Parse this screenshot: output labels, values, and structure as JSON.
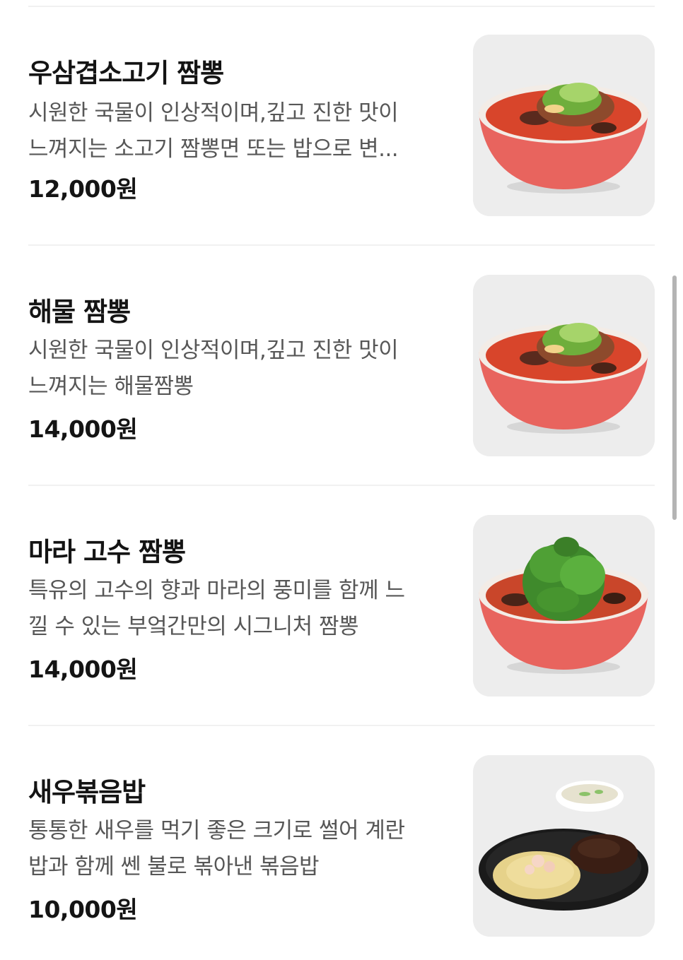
{
  "menu": {
    "items": [
      {
        "name": "우삼겹소고기 짬뽕",
        "desc_line1": "시원한 국물이 인상적이며,깊고 진한 맛이",
        "desc_line2": "느껴지는 소고기 짬뽕면 또는 밥으로 변...",
        "price": "12,000원",
        "image": "jjamppong-bowl-icon"
      },
      {
        "name": "해물 짬뽕",
        "desc_line1": "시원한 국물이 인상적이며,깊고 진한 맛이",
        "desc_line2": "느껴지는 해물짬뽕",
        "price": "14,000원",
        "image": "jjamppong-bowl-icon"
      },
      {
        "name": "마라 고수 짬뽕",
        "desc_line1": "특유의 고수의 향과 마라의 풍미를 함께 느",
        "desc_line2": "낄 수 있는 부엌간만의 시그니처 짬뽕",
        "price": "14,000원",
        "image": "coriander-jjamppong-bowl-icon"
      },
      {
        "name": "새우볶음밥",
        "desc_line1": "통통한 새우를 먹기 좋은 크기로 썰어 계란",
        "desc_line2": "밥과 함께 쎈 불로 볶아낸 볶음밥",
        "price": "10,000원",
        "image": "shrimp-fried-rice-plate-icon"
      }
    ]
  },
  "colors": {
    "background": "#ffffff",
    "title": "#141414",
    "description": "#575757",
    "divider": "#f1f1f1",
    "bowl": "#e8645e",
    "broth": "#d8452b"
  }
}
